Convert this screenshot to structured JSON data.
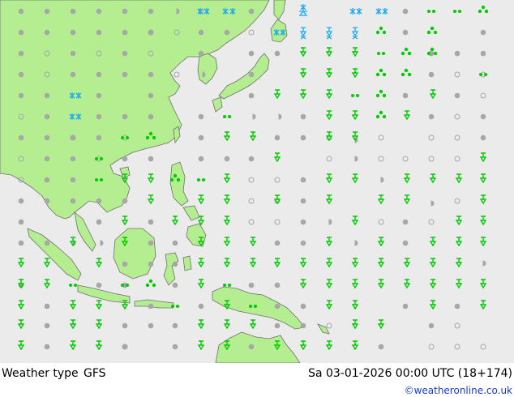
{
  "footer": {
    "title": "Weather type",
    "model": "GFS",
    "time": "Sa 03-01-2026 00:00 UTC (18+174)",
    "credit": "©weatheronline.co.uk"
  },
  "colors": {
    "sea": "#ebebeb",
    "land": "#b4ee90",
    "coast": "#6f6f6f",
    "cloud": "#a7a7a7",
    "rain": "#00cc00",
    "snow": "#1eaaf0"
  },
  "legend_icons": [
    "cloudy-dot",
    "partly-cloudy-circle",
    "half-cloud-circle",
    "light-rain-dots",
    "rain-shower-drop",
    "thunder-shower",
    "snow-asterisk",
    "snow-shower"
  ]
}
